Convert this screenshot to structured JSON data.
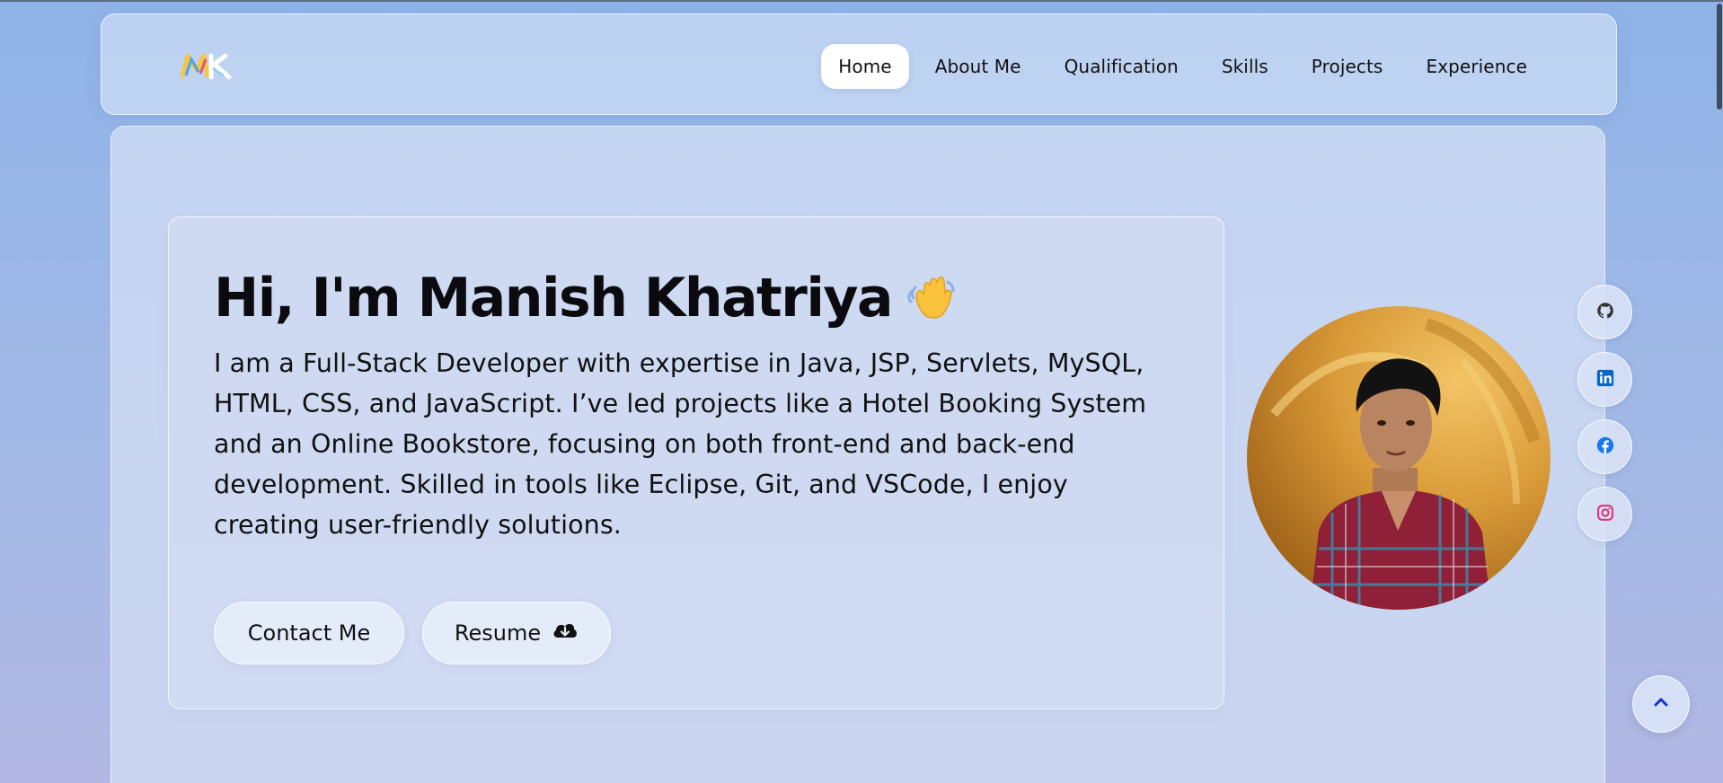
{
  "nav": {
    "items": [
      {
        "label": "Home",
        "active": true
      },
      {
        "label": "About Me",
        "active": false
      },
      {
        "label": "Qualification",
        "active": false
      },
      {
        "label": "Skills",
        "active": false
      },
      {
        "label": "Projects",
        "active": false
      },
      {
        "label": "Experience",
        "active": false
      }
    ]
  },
  "logo": {
    "icon": "mk-logo-icon",
    "text": "MK"
  },
  "hero": {
    "headline": "Hi, I'm Manish Khatriya",
    "headline_icon": "waving-hand-icon",
    "intro": "I am a Full-Stack Developer with expertise in Java, JSP, Servlets, MySQL, HTML, CSS, and JavaScript. I’ve led projects like a Hotel Booking System and an Online Bookstore, focusing on both front-end and back-end development. Skilled in tools like Eclipse, Git, and VSCode, I enjoy creating user-friendly solutions.",
    "contact_label": "Contact Me",
    "resume_label": "Resume",
    "resume_icon": "cloud-download-icon"
  },
  "avatar": {
    "icon": "profile-photo"
  },
  "social": [
    {
      "icon": "github-icon",
      "color": "#333333"
    },
    {
      "icon": "linkedin-icon",
      "color": "#0a66c2"
    },
    {
      "icon": "facebook-icon",
      "color": "#1877f2"
    },
    {
      "icon": "instagram-icon",
      "color": "#e1306c"
    }
  ],
  "scroll_top": {
    "icon": "chevron-up-icon",
    "color": "#1a2fd1"
  },
  "colors": {
    "background": "#9db5e6",
    "card": "#d6e0f5",
    "text": "#0b0b0f"
  }
}
